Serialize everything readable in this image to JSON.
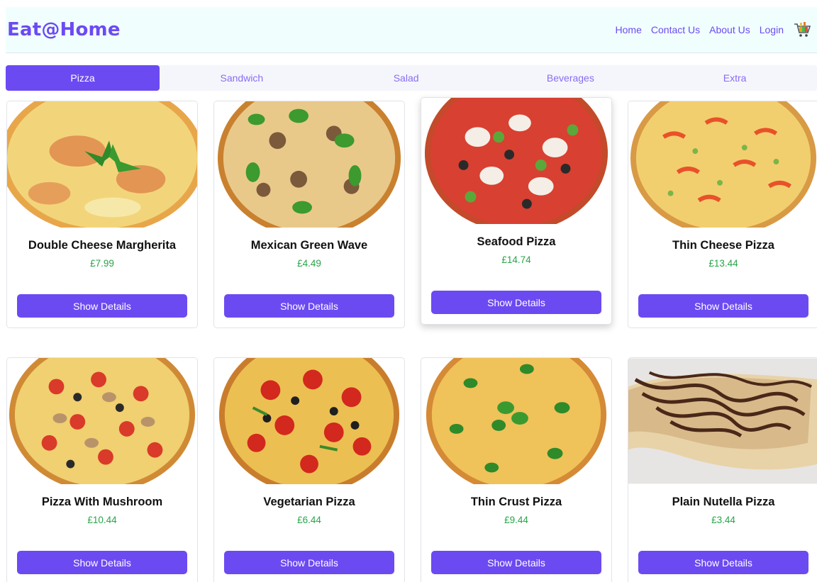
{
  "header": {
    "brand": "Eat@Home",
    "nav": [
      "Home",
      "Contact Us",
      "About Us",
      "Login"
    ],
    "cart_icon": "cart-icon"
  },
  "tabs": [
    {
      "label": "Pizza",
      "active": true
    },
    {
      "label": "Sandwich",
      "active": false
    },
    {
      "label": "Salad",
      "active": false
    },
    {
      "label": "Beverages",
      "active": false
    },
    {
      "label": "Extra",
      "active": false
    }
  ],
  "colors": {
    "accent": "#6c4af2",
    "price": "#27a548",
    "header_bg": "#f0fffe"
  },
  "products": [
    {
      "name": "Double Cheese Margherita",
      "price": "£7.99",
      "button": "Show Details"
    },
    {
      "name": "Mexican Green Wave",
      "price": "£4.49",
      "button": "Show Details"
    },
    {
      "name": "Seafood Pizza",
      "price": "£14.74",
      "button": "Show Details"
    },
    {
      "name": "Thin Cheese Pizza",
      "price": "£13.44",
      "button": "Show Details"
    },
    {
      "name": "Pizza With Mushroom",
      "price": "£10.44",
      "button": "Show Details"
    },
    {
      "name": "Vegetarian Pizza",
      "price": "£6.44",
      "button": "Show Details"
    },
    {
      "name": "Thin Crust Pizza",
      "price": "£9.44",
      "button": "Show Details"
    },
    {
      "name": "Plain Nutella Pizza",
      "price": "£3.44",
      "button": "Show Details"
    }
  ]
}
